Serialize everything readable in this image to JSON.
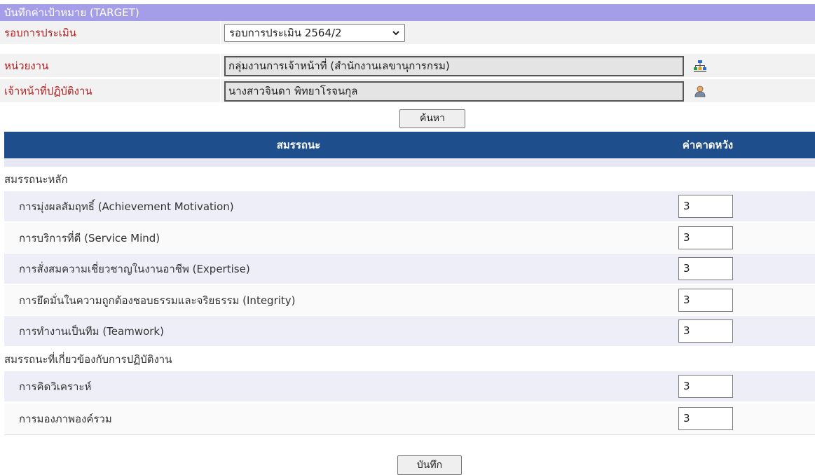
{
  "form": {
    "title": "บันทึกค่าเป้าหมาย (TARGET)",
    "round_label": "รอบการประเมิน",
    "round_selected": "รอบการประเมิน 2564/2",
    "unit_label": "หน่วยงาน",
    "unit_value": "กลุ่มงานการเจ้าหน้าที่ (สำนักงานเลขานุการกรม)",
    "staff_label": "เจ้าหน้าที่ปฏิบัติงาน",
    "staff_value": "นางสาวจินดา พิทยาโรจนกุล",
    "search_button": "ค้นหา"
  },
  "table": {
    "col_competency": "สมรรถนะ",
    "col_expected": "ค่าคาดหวัง",
    "groups": [
      {
        "name": "สมรรถนะหลัก",
        "items": [
          {
            "label": "การมุ่งผลสัมฤทธิ์ (Achievement Motivation)",
            "value": "3"
          },
          {
            "label": "การบริการที่ดี (Service Mind)",
            "value": "3"
          },
          {
            "label": "การสั่งสมความเชี่ยวชาญในงานอาชีพ (Expertise)",
            "value": "3"
          },
          {
            "label": "การยึดมั่นในความถูกต้องชอบธรรมและจริยธรรม (Integrity)",
            "value": "3"
          },
          {
            "label": "การทำงานเป็นทีม (Teamwork)",
            "value": "3"
          }
        ]
      },
      {
        "name": "สมรรถนะที่เกี่ยวข้องกับการปฏิบัติงาน",
        "items": [
          {
            "label": "การคิดวิเคราะห์",
            "value": "3"
          },
          {
            "label": "การมองภาพองค์รวม",
            "value": "3"
          }
        ]
      }
    ]
  },
  "save_button": "บันทึก",
  "icons": {
    "unit_icon": "org-chart-icon",
    "staff_icon": "user-icon",
    "select_icon": "chevron-down-icon"
  },
  "colors": {
    "title_bar": "#a49ee9",
    "header": "#1e4e8c",
    "label_red": "#b22222"
  }
}
